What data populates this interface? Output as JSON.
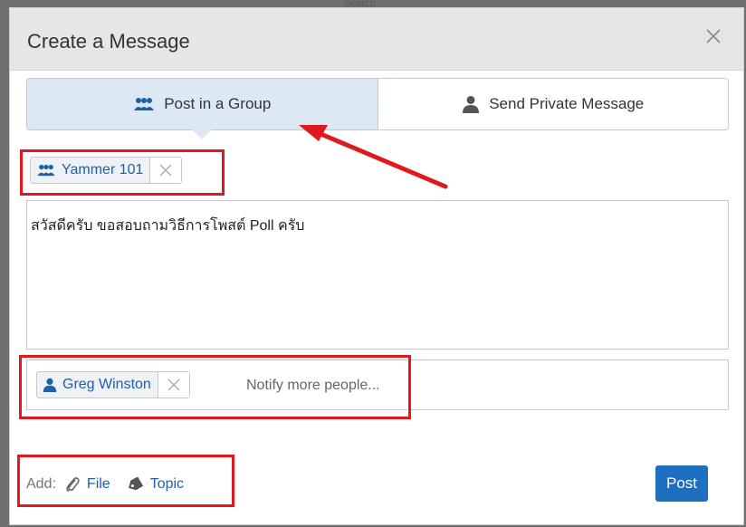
{
  "backdrop": {
    "search_text": "Search"
  },
  "modal": {
    "title": "Create a Message",
    "close_icon": "close-icon"
  },
  "tabs": [
    {
      "label": "Post in a Group",
      "icon": "group-icon",
      "active": true
    },
    {
      "label": "Send Private Message",
      "icon": "person-icon",
      "active": false
    }
  ],
  "group_tag": {
    "label": "Yammer 101",
    "icon": "group-icon"
  },
  "message": {
    "text": "สวัสดีครับ ขอสอบถามวิธีการโพสต์ Poll ครับ"
  },
  "notify": {
    "person_label": "Greg Winston",
    "placeholder": "Notify more people..."
  },
  "add": {
    "label": "Add:",
    "file_label": "File",
    "topic_label": "Topic"
  },
  "post_button": {
    "label": "Post"
  },
  "colors": {
    "accent": "#1f6fc1",
    "link": "#2060a8",
    "tab_active_bg": "#dce9f5",
    "annotation": "#e0191f"
  }
}
